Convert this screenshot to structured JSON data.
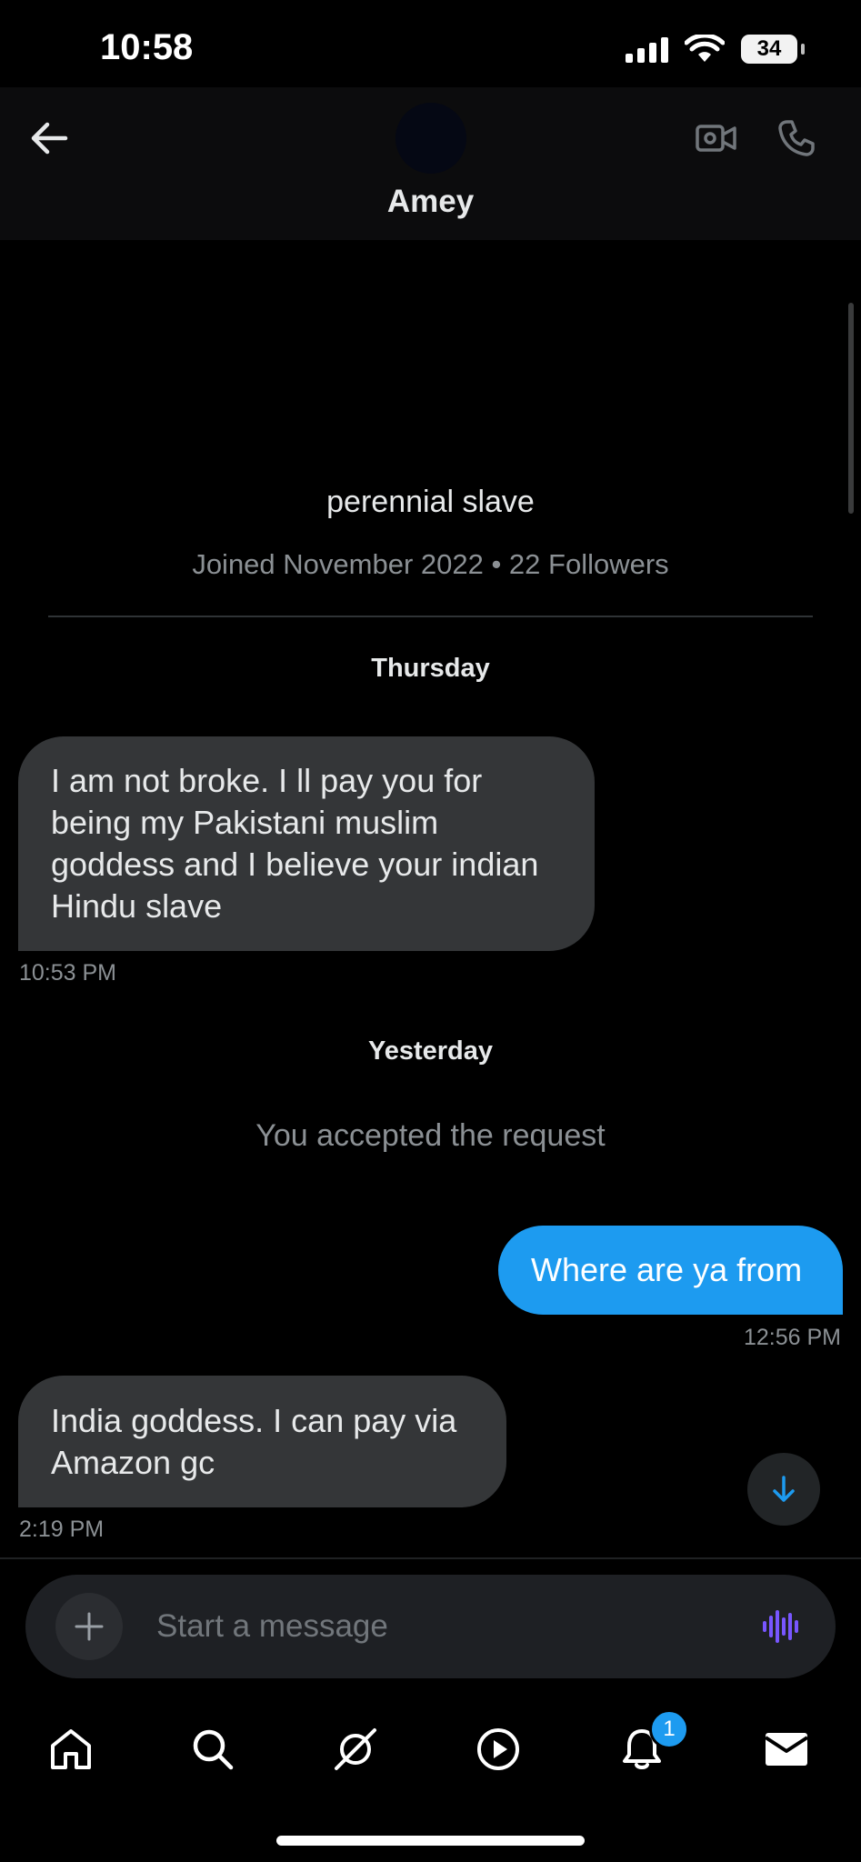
{
  "status_bar": {
    "time": "10:58",
    "battery": "34"
  },
  "header": {
    "title": "Amey"
  },
  "profile": {
    "bio": "perennial slave",
    "meta": "Joined November 2022 • 22 Followers"
  },
  "sections": {
    "thursday": "Thursday",
    "yesterday": "Yesterday"
  },
  "messages": [
    {
      "direction": "incoming",
      "lines": [
        "I am not broke. I ll pay you for",
        "being my Pakistani muslim",
        "goddess and I believe your indian",
        "Hindu slave"
      ],
      "time": "10:53 PM"
    },
    {
      "direction": "outgoing",
      "text": "Where are ya from",
      "time": "12:56 PM"
    },
    {
      "direction": "incoming",
      "lines": [
        "India goddess. I can pay via",
        "Amazon gc"
      ],
      "time": "2:19 PM"
    }
  ],
  "system_message": "You accepted the request",
  "composer": {
    "placeholder": "Start a message"
  },
  "nav": {
    "notifications_badge": "1"
  },
  "colors": {
    "accent": "#1d9bf0",
    "incoming_bubble": "#343638",
    "voice_icon": "#7856ff"
  },
  "icons": [
    "back-arrow-icon",
    "video-camera-icon",
    "phone-icon",
    "arrow-down-icon",
    "plus-icon",
    "voice-waveform-icon",
    "home-icon",
    "search-icon",
    "grok-icon",
    "play-icon",
    "bell-icon",
    "mail-icon"
  ]
}
